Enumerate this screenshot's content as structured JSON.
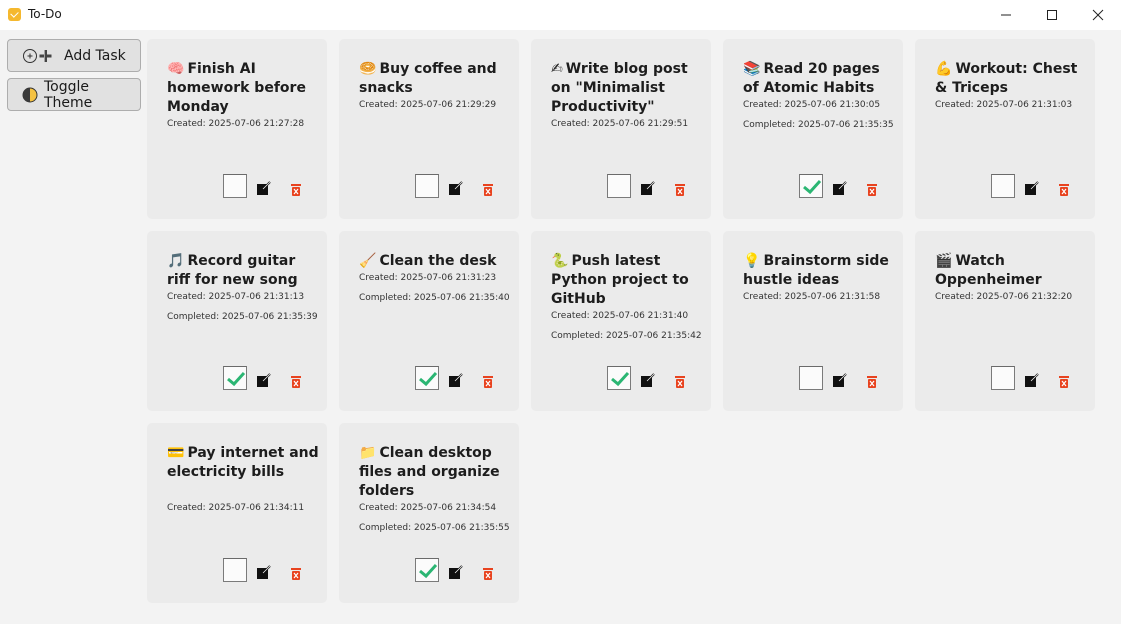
{
  "window": {
    "title": "To-Do"
  },
  "sidebar": {
    "add_task_label": "Add Task",
    "toggle_theme_label": "Toggle Theme"
  },
  "colors": {
    "check": "#2bb673",
    "delete": "#e8431f",
    "card_bg": "#ebebeb",
    "app_bg": "#f3f3f3"
  },
  "icons": {
    "add": "plus-circle-icon",
    "theme": "half-moon-icon",
    "edit": "edit-icon",
    "delete": "trash-icon"
  },
  "tasks": [
    {
      "emoji": "🧠",
      "title": "Finish AI homework before Monday",
      "created": "Created: 2025-07-06 21:27:28",
      "completed": "",
      "done": false
    },
    {
      "emoji": "🥯",
      "title": "Buy coffee and snacks",
      "created": "Created: 2025-07-06 21:29:29",
      "completed": "",
      "done": false
    },
    {
      "emoji": "✍",
      "title": "Write blog post on \"Minimalist Productivity\"",
      "created": "Created: 2025-07-06 21:29:51",
      "completed": "",
      "done": false
    },
    {
      "emoji": "📚",
      "title": "Read 20 pages of Atomic Habits",
      "created": "Created: 2025-07-06 21:30:05",
      "completed": "Completed: 2025-07-06 21:35:35",
      "done": true
    },
    {
      "emoji": "💪",
      "title": "Workout: Chest & Triceps",
      "created": "Created: 2025-07-06 21:31:03",
      "completed": "",
      "done": false
    },
    {
      "emoji": "🎵",
      "title": "Record guitar riff for new song",
      "created": "Created: 2025-07-06 21:31:13",
      "completed": "Completed: 2025-07-06 21:35:39",
      "done": true
    },
    {
      "emoji": "🧹",
      "title": "Clean the desk",
      "created": "Created: 2025-07-06 21:31:23",
      "completed": "Completed: 2025-07-06 21:35:40",
      "done": true
    },
    {
      "emoji": "🐍",
      "title": "Push latest Python project to GitHub",
      "created": "Created: 2025-07-06 21:31:40",
      "completed": "Completed: 2025-07-06 21:35:42",
      "done": true
    },
    {
      "emoji": "💡",
      "title": "Brainstorm side hustle ideas",
      "created": "Created: 2025-07-06 21:31:58",
      "completed": "",
      "done": false
    },
    {
      "emoji": "🎬",
      "title": "Watch Oppenheimer",
      "created": "Created: 2025-07-06 21:32:20",
      "completed": "",
      "done": false
    },
    {
      "emoji": "💳",
      "title": "Pay internet and electricity bills",
      "created": "Created: 2025-07-06 21:34:11",
      "completed": "",
      "done": false
    },
    {
      "emoji": "📁",
      "title": "Clean desktop files and organize folders",
      "created": "Created: 2025-07-06 21:34:54",
      "completed": "Completed: 2025-07-06 21:35:55",
      "done": true
    }
  ]
}
